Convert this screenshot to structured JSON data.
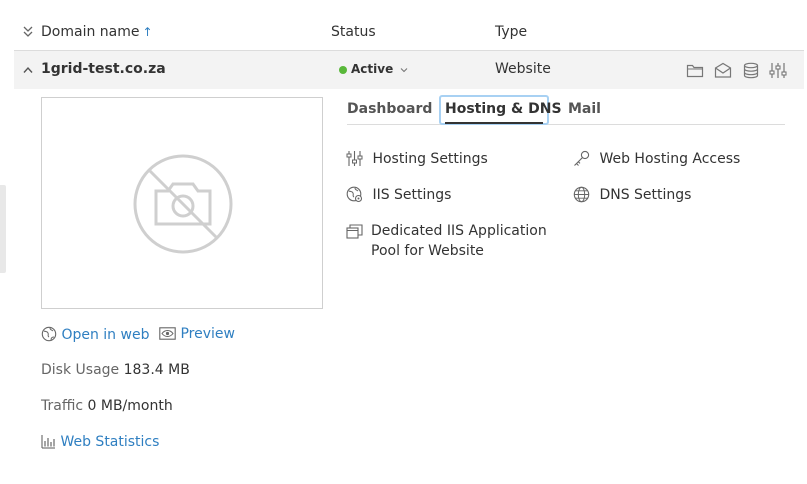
{
  "table": {
    "headers": {
      "domain_name": "Domain name",
      "sort_indicator": "↑",
      "status": "Status",
      "type": "Type"
    }
  },
  "domain": {
    "name": "1grid-test.co.za",
    "status": "Active",
    "type": "Website",
    "status_color": "#59b83a"
  },
  "preview_links": {
    "open_in_web": "Open in web",
    "preview": "Preview"
  },
  "stats": {
    "disk_usage_label": "Disk Usage",
    "disk_usage_value": "183.4 MB",
    "traffic_label": "Traffic",
    "traffic_value": "0 MB/month",
    "web_statistics": "Web Statistics"
  },
  "tabs": [
    {
      "label": "Dashboard",
      "active": false
    },
    {
      "label": "Hosting & DNS",
      "active": true
    },
    {
      "label": "Mail",
      "active": false
    }
  ],
  "hosting_menu": {
    "hosting_settings": "Hosting Settings",
    "web_hosting_access": "Web Hosting Access",
    "iis_settings": "IIS Settings",
    "dns_settings": "DNS Settings",
    "dedicated_pool_line1": "Dedicated IIS Application",
    "dedicated_pool_line2": "Pool for Website"
  },
  "colors": {
    "link": "#2f7fc1",
    "focus_ring": "#a8d1f3"
  },
  "icons": [
    "collapse-all-icon",
    "chevron-up-icon",
    "chevron-down-icon",
    "folder-icon",
    "mail-icon",
    "database-icon",
    "sliders-icon",
    "no-screenshot-icon",
    "globe-icon",
    "eye-icon",
    "bar-chart-icon",
    "key-icon",
    "windows-pool-icon"
  ]
}
